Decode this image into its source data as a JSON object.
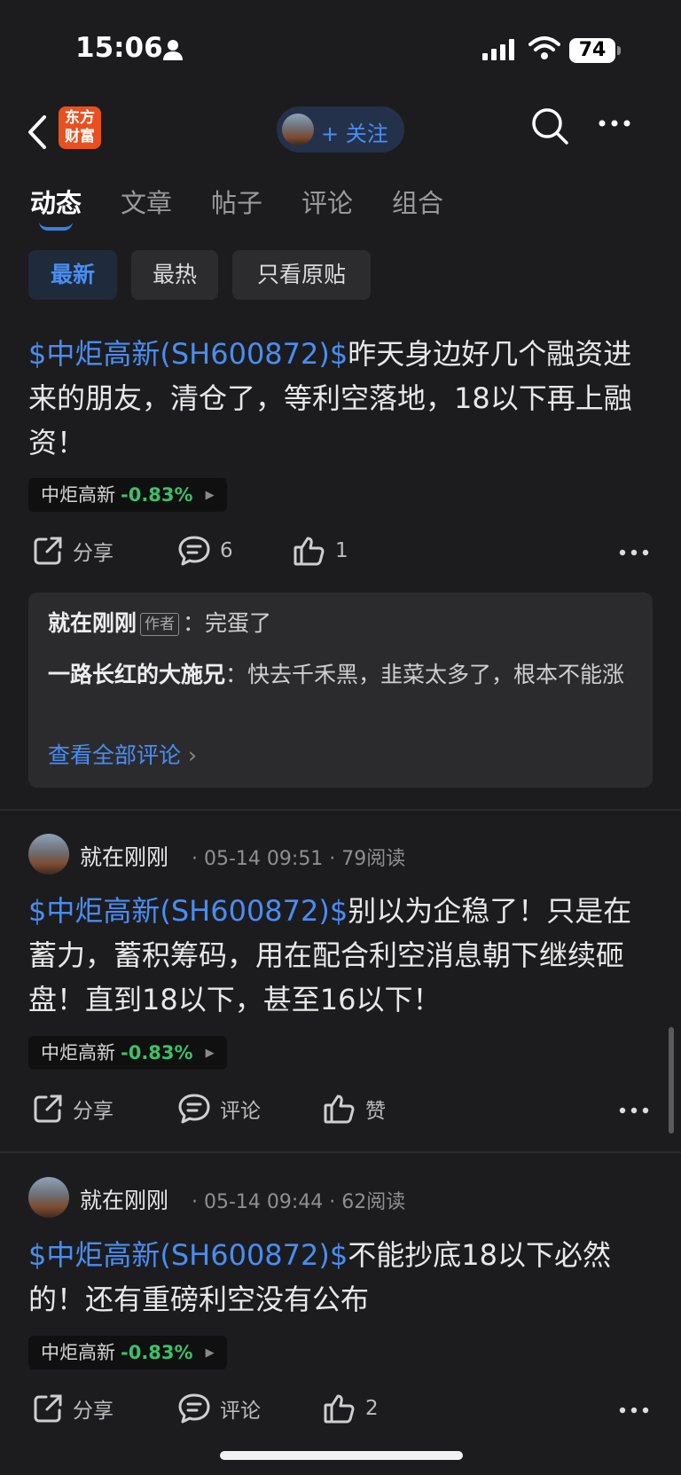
{
  "status_bar": {
    "time": "15:06",
    "battery": "74"
  },
  "nav": {
    "logo_line1": "东方",
    "logo_line2": "财富",
    "follow_label": "+ 关注"
  },
  "tabs": [
    {
      "label": "动态",
      "active": true
    },
    {
      "label": "文章",
      "active": false
    },
    {
      "label": "帖子",
      "active": false
    },
    {
      "label": "评论",
      "active": false
    },
    {
      "label": "组合",
      "active": false
    }
  ],
  "filters": [
    {
      "label": "最新",
      "active": true
    },
    {
      "label": "最热",
      "active": false
    },
    {
      "label": "只看原贴",
      "active": false
    }
  ],
  "posts": [
    {
      "tag": "$中炬高新(SH600872)$",
      "text": "昨天身边好几个融资进来的朋友，清仓了，等利空落地，18以下再上融资！",
      "stock_name": "中炬高新",
      "stock_change": "-0.83%",
      "share_label": "分享",
      "comment_label": "6",
      "like_label": "1",
      "comments": [
        {
          "user": "就在刚刚",
          "badge": "作者",
          "text": "：完蛋了"
        },
        {
          "user": "一路长红的大施兄",
          "text": "：快去千禾黑，韭菜太多了，根本不能涨"
        }
      ],
      "view_all": "查看全部评论"
    },
    {
      "author": "就在刚刚",
      "meta": "· 05-14 09:51 · 79阅读",
      "tag": "$中炬高新(SH600872)$",
      "text": "别以为企稳了！只是在蓄力，蓄积筹码，用在配合利空消息朝下继续砸盘！直到18以下，甚至16以下！",
      "stock_name": "中炬高新",
      "stock_change": "-0.83%",
      "share_label": "分享",
      "comment_label": "评论",
      "like_label": "赞"
    },
    {
      "author": "就在刚刚",
      "meta": "· 05-14 09:44 · 62阅读",
      "tag": "$中炬高新(SH600872)$",
      "text": "不能抄底18以下必然的！还有重磅利空没有公布",
      "stock_name": "中炬高新",
      "stock_change": "-0.83%",
      "share_label": "分享",
      "comment_label": "评论",
      "like_label": "2"
    }
  ],
  "colors": {
    "accent": "#4a8df2",
    "positive_change": "#3fbf6a",
    "background": "#1c1c1e"
  }
}
